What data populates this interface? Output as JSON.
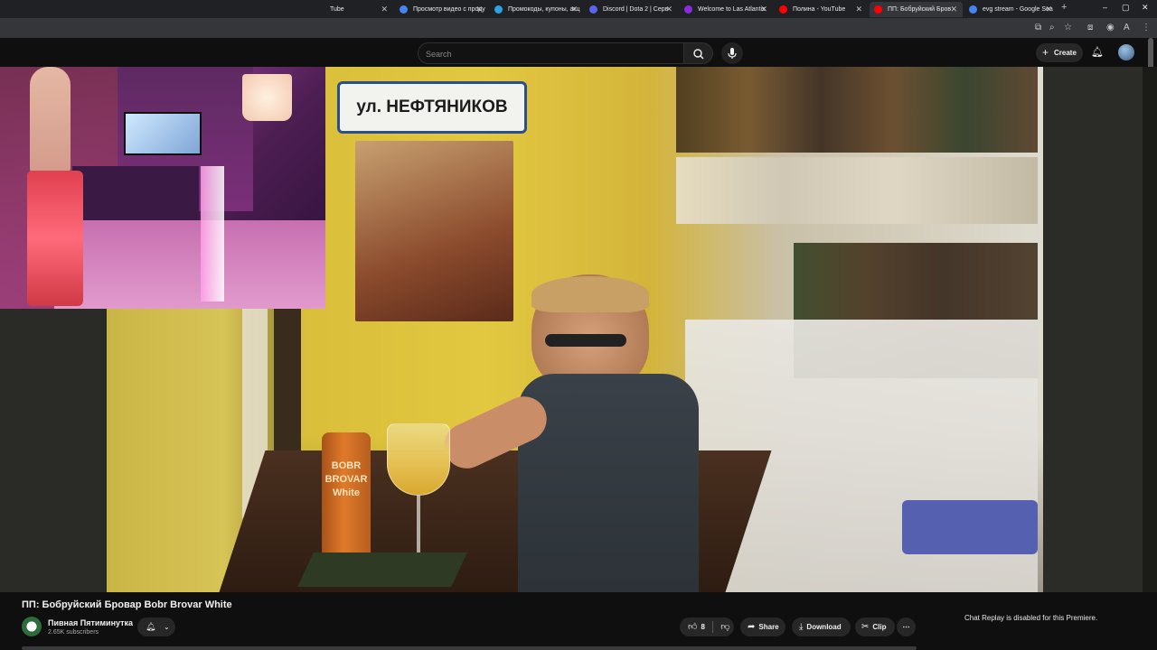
{
  "browser": {
    "tabs": [
      {
        "label": "Tube",
        "color": "#ff0000"
      },
      {
        "label": "Просмотр видео с проду",
        "color": "#4285f4"
      },
      {
        "label": "Промокоды, купоны, акц",
        "color": "#2aa3e6"
      },
      {
        "label": "Discord | Dota 2 | Серв",
        "color": "#5865f2"
      },
      {
        "label": "Welcome to Las Atlantis",
        "color": "#8a2be2"
      },
      {
        "label": "Полина - YouTube",
        "color": "#ff0000"
      },
      {
        "label": "ПП: Бобруйский Бров",
        "color": "#ff0000"
      },
      {
        "label": "evg stream - Google Sea",
        "color": "#4285f4"
      }
    ],
    "new_tab": "+",
    "window_controls": [
      "–",
      "▢",
      "✕"
    ]
  },
  "masthead": {
    "search_placeholder": "Search",
    "create_label": "Create"
  },
  "video": {
    "title": "ПП: Бобруйский Бровар Bobr Brovar White",
    "poster_text": "ул. НЕФТЯНИКОВ",
    "can_text": "BOBR BROVAR White"
  },
  "channel": {
    "name": "Пивная Пятиминутка",
    "subscribers": "2.65K subscribers"
  },
  "actions": {
    "likes": "8",
    "share": "Share",
    "download": "Download",
    "clip": "Clip",
    "more": "⋯"
  },
  "chat": {
    "replay_notice": "Chat Replay is disabled for this Premiere."
  },
  "icons": {
    "like": "thumbs-up-icon",
    "dislike": "thumbs-down-icon",
    "share": "share-icon",
    "download": "download-icon",
    "clip": "scissors-icon",
    "bell": "bell-icon",
    "search": "search-icon",
    "mic": "microphone-icon"
  }
}
